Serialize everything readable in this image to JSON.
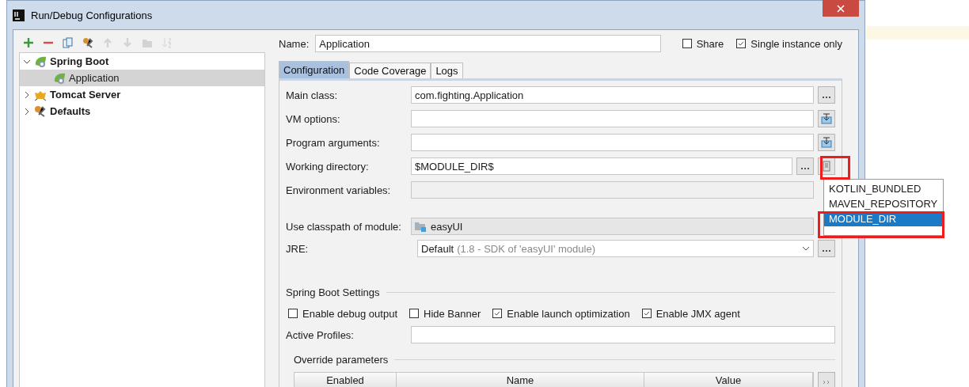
{
  "window": {
    "title": "Run/Debug Configurations"
  },
  "toolbar": [
    {
      "kind": "add",
      "disabled": false
    },
    {
      "kind": "remove",
      "disabled": false
    },
    {
      "kind": "copy",
      "disabled": false
    },
    {
      "kind": "wrench",
      "disabled": false
    },
    {
      "kind": "up",
      "disabled": true
    },
    {
      "kind": "down",
      "disabled": true
    },
    {
      "kind": "folder",
      "disabled": true
    },
    {
      "kind": "sort",
      "disabled": true
    }
  ],
  "tree": [
    {
      "label": "Spring Boot",
      "kind": "spring",
      "expanded": true,
      "selected": false,
      "children": [
        {
          "label": "Application",
          "kind": "spring",
          "selected": true
        }
      ]
    },
    {
      "label": "Tomcat Server",
      "kind": "tomcat",
      "expanded": false,
      "selected": false
    },
    {
      "label": "Defaults",
      "kind": "wrench",
      "expanded": false,
      "selected": false
    }
  ],
  "name_field": {
    "label": "Name:",
    "value": "Application"
  },
  "options": [
    {
      "label": "Share",
      "checked": false
    },
    {
      "label": "Single instance only",
      "checked": true
    }
  ],
  "tabs": [
    {
      "label": "Configuration",
      "selected": true
    },
    {
      "label": "Code Coverage",
      "selected": false
    },
    {
      "label": "Logs",
      "selected": false
    }
  ],
  "fields": [
    {
      "label": "Main class:",
      "value": "com.fighting.Application",
      "kind": "browse"
    },
    {
      "label": "VM options:",
      "kind": "expand"
    },
    {
      "label": "Program arguments:",
      "kind": "expand"
    },
    {
      "label": "Working directory:",
      "value": "$MODULE_DIR$",
      "kind": "macro"
    },
    {
      "label": "Environment variables:",
      "kind": "env"
    },
    {
      "label": "Use classpath of module:",
      "value": "easyUI",
      "kind": "module"
    },
    {
      "label": "JRE:",
      "value": "Default",
      "hint": "(1.8 - SDK of 'easyUI' module)",
      "kind": "jre"
    }
  ],
  "spring_boot_settings": {
    "title": "Spring Boot Settings",
    "checkboxes": [
      {
        "label": "Enable debug output",
        "checked": false
      },
      {
        "label": "Hide Banner",
        "checked": false
      },
      {
        "label": "Enable launch optimization",
        "checked": true
      },
      {
        "label": "Enable JMX agent",
        "checked": true
      }
    ],
    "active_profiles": {
      "label": "Active Profiles:"
    }
  },
  "override": {
    "title": "Override parameters",
    "columns": [
      "Enabled",
      "Name",
      "Value"
    ]
  },
  "macro_popup": {
    "items": [
      {
        "label": "KOTLIN_BUNDLED",
        "selected": false
      },
      {
        "label": "MAVEN_REPOSITORY",
        "selected": false
      },
      {
        "label": "MODULE_DIR",
        "selected": true
      }
    ]
  }
}
